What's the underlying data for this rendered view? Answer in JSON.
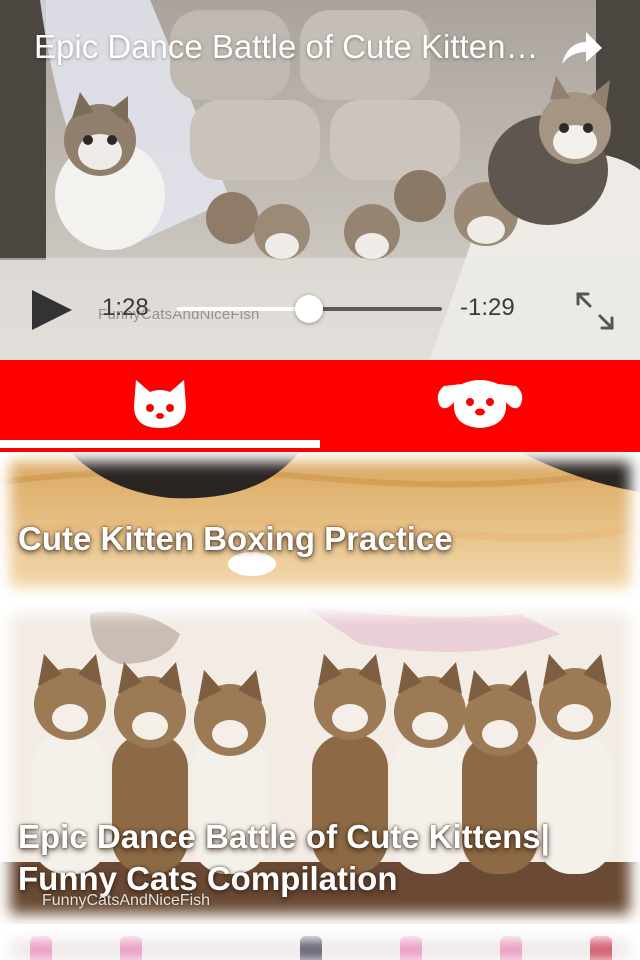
{
  "player": {
    "title": "Epic Dance Battle of Cute Kittens| Funny Cats Compilation",
    "elapsed": "1:28",
    "remaining": "-1:29",
    "progress": 0.5,
    "watermark": "FunnyCatsAndNiceFish",
    "icons": {
      "share": "share-arrow-icon",
      "play": "play-icon",
      "fullscreen": "expand-arrows-icon"
    }
  },
  "tabs": [
    {
      "name": "cats",
      "icon": "cat-face-icon",
      "selected": true
    },
    {
      "name": "dogs",
      "icon": "dog-face-icon",
      "selected": false
    }
  ],
  "colors": {
    "tab_bar": "#fe0000",
    "tab_icon": "#ffffff",
    "indicator": "#ffffff"
  },
  "videos": [
    {
      "title": "Cute Kitten Boxing Practice",
      "watermark": ""
    },
    {
      "title_line1": "Epic Dance Battle of Cute Kittens|",
      "title_line2": "Funny Cats Compilation",
      "watermark": "FunnyCatsAndNiceFish"
    }
  ]
}
